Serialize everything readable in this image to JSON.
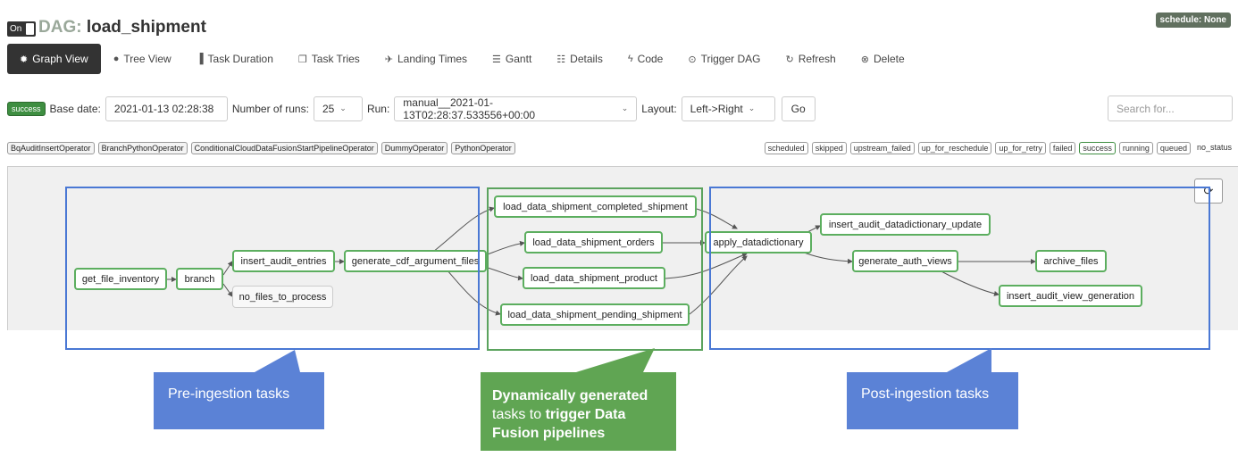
{
  "header": {
    "toggle_label": "On",
    "dag_prefix": "DAG:",
    "dag_name": "load_shipment",
    "schedule": "schedule: None"
  },
  "nav": {
    "graph_view": "Graph View",
    "tree_view": "Tree View",
    "task_duration": "Task Duration",
    "task_tries": "Task Tries",
    "landing_times": "Landing Times",
    "gantt": "Gantt",
    "details": "Details",
    "code": "Code",
    "trigger_dag": "Trigger DAG",
    "refresh": "Refresh",
    "delete": "Delete"
  },
  "controls": {
    "status": "success",
    "base_date_label": "Base date:",
    "base_date_value": "2021-01-13 02:28:38",
    "num_runs_label": "Number of runs:",
    "num_runs_value": "25",
    "run_label": "Run:",
    "run_value": "manual__2021-01-13T02:28:37.533556+00:00",
    "layout_label": "Layout:",
    "layout_value": "Left->Right",
    "go_label": "Go",
    "search_placeholder": "Search for..."
  },
  "operators": [
    "BqAuditInsertOperator",
    "BranchPythonOperator",
    "ConditionalCloudDataFusionStartPipelineOperator",
    "DummyOperator",
    "PythonOperator"
  ],
  "states": [
    "scheduled",
    "skipped",
    "upstream_failed",
    "up_for_reschedule",
    "up_for_retry",
    "failed",
    "success",
    "running",
    "queued",
    "no_status"
  ],
  "tasks": {
    "get_file_inventory": "get_file_inventory",
    "branch": "branch",
    "insert_audit_entries": "insert_audit_entries",
    "no_files_to_process": "no_files_to_process",
    "generate_cdf_argument_files": "generate_cdf_argument_files",
    "completed_shipment": "load_data_shipment_completed_shipment",
    "orders": "load_data_shipment_orders",
    "product": "load_data_shipment_product",
    "pending_shipment": "load_data_shipment_pending_shipment",
    "apply_datadictionary": "apply_datadictionary",
    "insert_audit_datadictionary_update": "insert_audit_datadictionary_update",
    "generate_auth_views": "generate_auth_views",
    "archive_files": "archive_files",
    "insert_audit_view_generation": "insert_audit_view_generation"
  },
  "callouts": {
    "pre": "Pre-ingestion tasks",
    "dyn_bold1": "Dynamically generated",
    "dyn_plain": "tasks to ",
    "dyn_bold2": "trigger Data",
    "dyn_bold3": "Fusion pipelines",
    "post": "Post-ingestion tasks"
  },
  "colors": {
    "success_green": "#5cae5f",
    "callout_blue": "#5b82d6",
    "callout_green": "#60a553",
    "nav_active": "#333333"
  },
  "icons": {
    "refresh_graph": "refresh-icon"
  }
}
